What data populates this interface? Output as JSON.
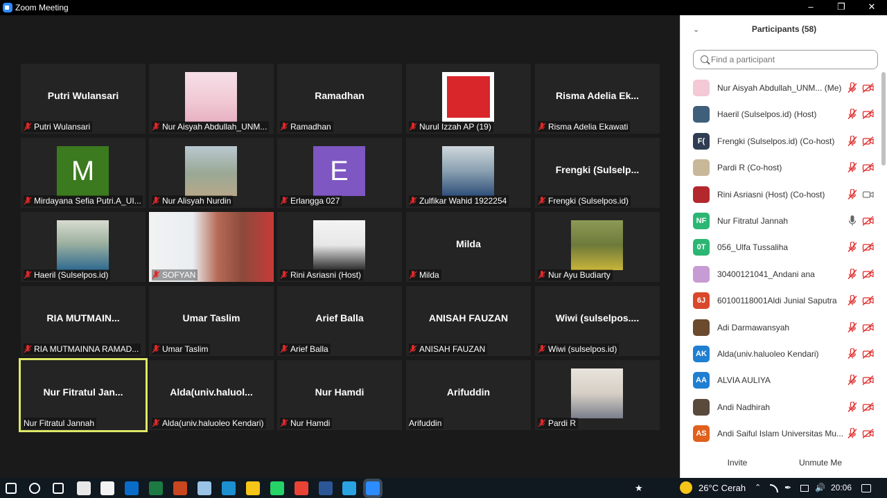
{
  "window": {
    "title": "Zoom Meeting",
    "minimize": "–",
    "restore": "❐",
    "close": "✕"
  },
  "gallery": {
    "tiles": [
      {
        "bigname": "Putri Wulansari",
        "caption": "Putri Wulansari",
        "muted": true
      },
      {
        "bigname": "",
        "caption": "Nur Aisyah Abdullah_UNM...",
        "muted": true,
        "photo": "hijab-illustration"
      },
      {
        "bigname": "Ramadhan",
        "caption": "Ramadhan",
        "muted": true
      },
      {
        "bigname": "",
        "caption": "Nurul Izzah AP (19)",
        "muted": true,
        "photo": "portrait-red"
      },
      {
        "bigname": "Risma  Adelia  Ek...",
        "caption": "Risma Adelia Ekawati",
        "muted": true
      },
      {
        "bigname": "",
        "caption": "Mirdayana Sefia Putri.A_UI...",
        "muted": true,
        "letter": "M",
        "letter_color": "#3b7a1f"
      },
      {
        "bigname": "",
        "caption": "Nur Alisyah Nurdin",
        "muted": true,
        "photo": "outdoor-hijab"
      },
      {
        "bigname": "",
        "caption": "Erlangga 027",
        "muted": true,
        "letter": "E",
        "letter_color": "#7e57c2"
      },
      {
        "bigname": "",
        "caption": "Zulfikar Wahid 1922254",
        "muted": true,
        "photo": "portrait-blue"
      },
      {
        "bigname": "Frengki  (Sulselp...",
        "caption": "Frengki (Sulselpos.id)",
        "muted": true
      },
      {
        "bigname": "",
        "caption": "Haeril (Sulselpos.id)",
        "muted": true,
        "photo": "man-outdoor"
      },
      {
        "bigname": "",
        "caption": "SOFYAN",
        "muted": true,
        "photo": "video-live"
      },
      {
        "bigname": "",
        "caption": "Rini Asriasni (Host)",
        "muted": true,
        "photo": "woman-white"
      },
      {
        "bigname": "Milda",
        "caption": "Milda",
        "muted": true
      },
      {
        "bigname": "",
        "caption": "Nur Ayu Budiarty",
        "muted": true,
        "photo": "garden"
      },
      {
        "bigname": "RIA  MUTMAIN...",
        "caption": "RIA MUTMAINNA RAMAD...",
        "muted": true
      },
      {
        "bigname": "Umar Taslim",
        "caption": "Umar Taslim",
        "muted": true
      },
      {
        "bigname": "Arief Balla",
        "caption": "Arief Balla",
        "muted": true
      },
      {
        "bigname": "ANISAH FAUZAN",
        "caption": "ANISAH FAUZAN",
        "muted": true
      },
      {
        "bigname": "Wiwi  (sulselpos....",
        "caption": "Wiwi (sulselpos.id)",
        "muted": true
      },
      {
        "bigname": "Nur  Fitratul  Jan...",
        "caption": "Nur Fitratul Jannah",
        "muted": false,
        "active": true
      },
      {
        "bigname": "Alda(univ.haluol...",
        "caption": "Alda(univ.haluoleo Kendari)",
        "muted": true
      },
      {
        "bigname": "Nur Hamdi",
        "caption": "Nur Hamdi",
        "muted": true
      },
      {
        "bigname": "Arifuddin",
        "caption": "Arifuddin",
        "muted": false
      },
      {
        "bigname": "",
        "caption": "Pardi R",
        "muted": true,
        "photo": "man-hat"
      }
    ]
  },
  "participants": {
    "title": "Participants (58)",
    "search_placeholder": "Find a participant",
    "items": [
      {
        "name": "Nur Aisyah Abdullah_UNM...  (Me)",
        "avatar": "img",
        "color": "#f3c9d6",
        "mic": "muted",
        "cam": "off"
      },
      {
        "name": "Haeril (Sulselpos.id) (Host)",
        "avatar": "img",
        "color": "#3f5f7a",
        "mic": "muted",
        "cam": "off"
      },
      {
        "name": "Frengki (Sulselpos.id) (Co-host)",
        "avatar": "F(",
        "color": "#2f3d52",
        "mic": "muted",
        "cam": "off"
      },
      {
        "name": "Pardi R (Co-host)",
        "avatar": "img",
        "color": "#c9b79a",
        "mic": "muted",
        "cam": "off"
      },
      {
        "name": "Rini Asriasni (Host) (Co-host)",
        "avatar": "img",
        "color": "#b3282d",
        "mic": "muted",
        "cam": "on"
      },
      {
        "name": "Nur Fitratul Jannah",
        "avatar": "NF",
        "color": "#2bb673",
        "mic": "on",
        "cam": "off"
      },
      {
        "name": "056_Ulfa Tussaliha",
        "avatar": "0T",
        "color": "#2bb673",
        "mic": "muted",
        "cam": "off"
      },
      {
        "name": "30400121041_Andani ana",
        "avatar": "img",
        "color": "#c79bd3",
        "mic": "muted",
        "cam": "off"
      },
      {
        "name": "60100118001Aldi Junial Saputra",
        "avatar": "6J",
        "color": "#d9482b",
        "mic": "muted",
        "cam": "off"
      },
      {
        "name": "Adi Darmawansyah",
        "avatar": "img",
        "color": "#6b4a2e",
        "mic": "muted",
        "cam": "off"
      },
      {
        "name": "Alda(univ.haluoleo Kendari)",
        "avatar": "AK",
        "color": "#1f7fd1",
        "mic": "muted",
        "cam": "off"
      },
      {
        "name": "ALVIA AULIYA",
        "avatar": "AA",
        "color": "#1f7fd1",
        "mic": "muted",
        "cam": "off"
      },
      {
        "name": "Andi Nadhirah",
        "avatar": "img",
        "color": "#5a4a3c",
        "mic": "muted",
        "cam": "off"
      },
      {
        "name": "Andi Saiful Islam Universitas Mu...",
        "avatar": "AS",
        "color": "#e0601c",
        "mic": "muted",
        "cam": "off"
      }
    ],
    "invite_label": "Invite",
    "unmute_label": "Unmute Me"
  },
  "taskbar": {
    "weather": "26°C  Cerah",
    "time": "20:06",
    "icons": [
      "windows-start-icon",
      "search-icon",
      "task-view-icon",
      "amazon-icon",
      "store-icon",
      "mail-icon",
      "excel-icon",
      "powerpoint-icon",
      "paint-icon",
      "edge-icon",
      "file-explorer-icon",
      "whatsapp-icon",
      "chrome-icon",
      "word-icon",
      "telegram-icon",
      "zoom-icon"
    ]
  },
  "colors": {
    "active_border": "#dfe867",
    "muted_red": "#e02828",
    "panel_bg": "#ffffff",
    "gallery_bg": "#1a1a1a",
    "tile_bg": "#242424"
  }
}
